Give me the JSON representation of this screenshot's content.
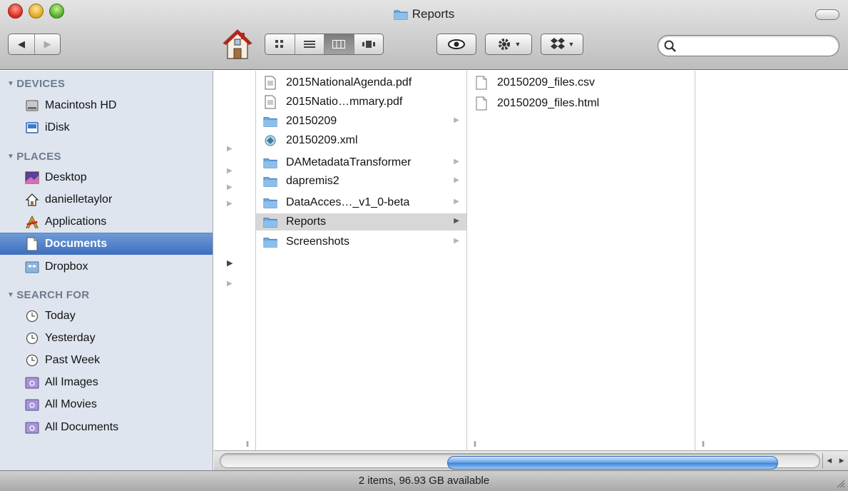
{
  "window": {
    "title": "Reports"
  },
  "toolbar": {
    "back_icon": "left-arrow-icon",
    "forward_icon": "right-arrow-icon",
    "view_modes": [
      "icon-view",
      "list-view",
      "column-view",
      "cover-flow-view"
    ],
    "active_view": "column-view",
    "search_placeholder": ""
  },
  "sidebar": {
    "devices": {
      "header": "DEVICES",
      "items": [
        {
          "label": "Macintosh HD",
          "icon": "hard-drive-icon"
        },
        {
          "label": "iDisk",
          "icon": "idisk-icon"
        }
      ]
    },
    "places": {
      "header": "PLACES",
      "items": [
        {
          "label": "Desktop",
          "icon": "desktop-icon"
        },
        {
          "label": "danielletaylor",
          "icon": "home-icon"
        },
        {
          "label": "Applications",
          "icon": "applications-icon"
        },
        {
          "label": "Documents",
          "icon": "documents-icon"
        },
        {
          "label": "Dropbox",
          "icon": "dropbox-icon"
        }
      ]
    },
    "search_for": {
      "header": "SEARCH FOR",
      "items": [
        {
          "label": "Today",
          "icon": "clock-icon"
        },
        {
          "label": "Yesterday",
          "icon": "clock-icon"
        },
        {
          "label": "Past Week",
          "icon": "clock-icon"
        },
        {
          "label": "All Images",
          "icon": "smart-folder-icon"
        },
        {
          "label": "All Movies",
          "icon": "smart-folder-icon"
        },
        {
          "label": "All Documents",
          "icon": "smart-folder-icon"
        }
      ]
    },
    "selected": "Documents"
  },
  "columns": {
    "documents": [
      {
        "name": "2015NationalAgenda.pdf",
        "kind": "pdf"
      },
      {
        "name": "2015Natio…mmary.pdf",
        "kind": "pdf"
      },
      {
        "name": "20150209",
        "kind": "folder"
      },
      {
        "name": "20150209.xml",
        "kind": "xml"
      },
      {
        "name": "DAMetadataTransformer",
        "kind": "folder"
      },
      {
        "name": "dapremis2",
        "kind": "folder"
      },
      {
        "name": "DataAcces…_v1_0-beta",
        "kind": "folder"
      },
      {
        "name": "Reports",
        "kind": "folder"
      },
      {
        "name": "Screenshots",
        "kind": "folder"
      }
    ],
    "selected_folder": "Reports",
    "reports": [
      {
        "name": "20150209_files.csv",
        "kind": "file"
      },
      {
        "name": "20150209_files.html",
        "kind": "file"
      }
    ]
  },
  "status": {
    "text": "2 items, 96.93 GB available"
  }
}
